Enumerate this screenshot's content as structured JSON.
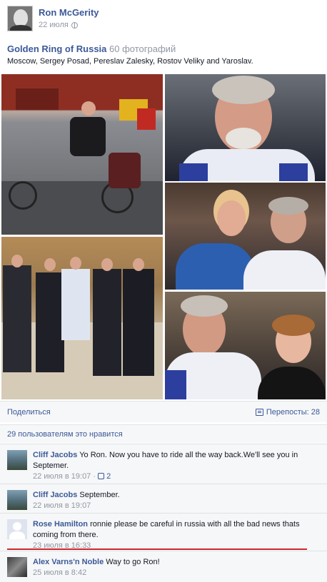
{
  "post": {
    "author": "Ron McGerity",
    "date": "22 июля",
    "album_title": "Golden Ring of Russia",
    "album_count": "60 фотографий",
    "album_description": "Moscow, Sergey Posad, Pereslav Zalesky, Rostov Veliky and Yaroslav."
  },
  "actions": {
    "share_label": "Поделиться",
    "reposts_label": "Перепосты: 28"
  },
  "likes": {
    "text": "29 пользователям это нравится"
  },
  "comments": [
    {
      "author": "Cliff Jacobs",
      "text": "Yo Ron. Now you have to ride all the way back.We'll see you in Septemer.",
      "meta": "22 июля в 19:07",
      "likes": "2"
    },
    {
      "author": "Cliff Jacobs",
      "text": "September.",
      "meta": "22 июля в 19:07"
    },
    {
      "author": "Rose Hamilton",
      "text": "ronnie please be careful in russia with all the bad news thats coming from there.",
      "meta": "23 июля в 16:33"
    },
    {
      "author": "Alex Varns'n Noble",
      "text": "Way to go Ron!",
      "meta": "25 июля в 8:42"
    }
  ],
  "colors": {
    "link": "#3b5998",
    "meta": "#9197a3",
    "highlight_line": "#d0272c"
  }
}
